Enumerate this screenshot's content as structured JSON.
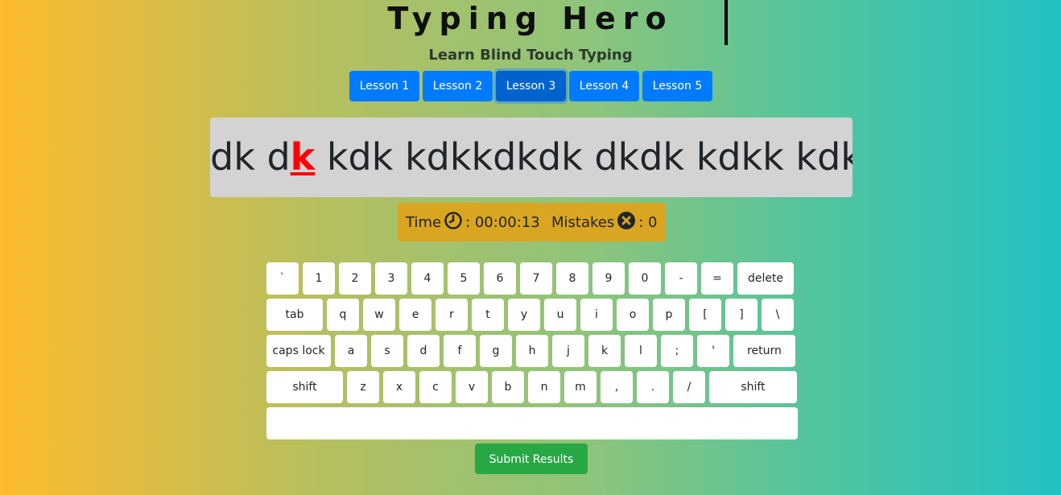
{
  "header": {
    "title": "Typing Hero",
    "subtitle": "Learn Blind Touch Typing"
  },
  "lessons": [
    {
      "label": "Lesson 1",
      "active": false
    },
    {
      "label": "Lesson 2",
      "active": false
    },
    {
      "label": "Lesson 3",
      "active": true
    },
    {
      "label": "Lesson 4",
      "active": false
    },
    {
      "label": "Lesson 5",
      "active": false
    }
  ],
  "exercise": {
    "before": "dk d",
    "current": "k",
    "after": " kdk kdkkdkdk dkdk kdkk kdk"
  },
  "stats": {
    "time_label": "Time",
    "time_icon": "clock-icon",
    "time_value": ": 00:00:13",
    "mistakes_label": "Mistakes",
    "mistakes_icon": "x-circle-icon",
    "mistakes_value": ": 0"
  },
  "keyboard": {
    "rows": [
      [
        "`",
        "1",
        "2",
        "3",
        "4",
        "5",
        "6",
        "7",
        "8",
        "9",
        "0",
        "-",
        "=",
        "delete"
      ],
      [
        "tab",
        "q",
        "w",
        "e",
        "r",
        "t",
        "y",
        "u",
        "i",
        "o",
        "p",
        "[",
        "]",
        "\\"
      ],
      [
        "caps lock",
        "a",
        "s",
        "d",
        "f",
        "g",
        "h",
        "j",
        "k",
        "l",
        ";",
        "'",
        "return"
      ],
      [
        "shift",
        "z",
        "x",
        "c",
        "v",
        "b",
        "n",
        "m",
        ",",
        ".",
        "/",
        "shift"
      ]
    ]
  },
  "submit_label": "Submit Results",
  "colors": {
    "lesson_button": "#007bff",
    "stat_background": "#daa520",
    "submit_button": "#28a745",
    "current_char": "#ff0000"
  }
}
